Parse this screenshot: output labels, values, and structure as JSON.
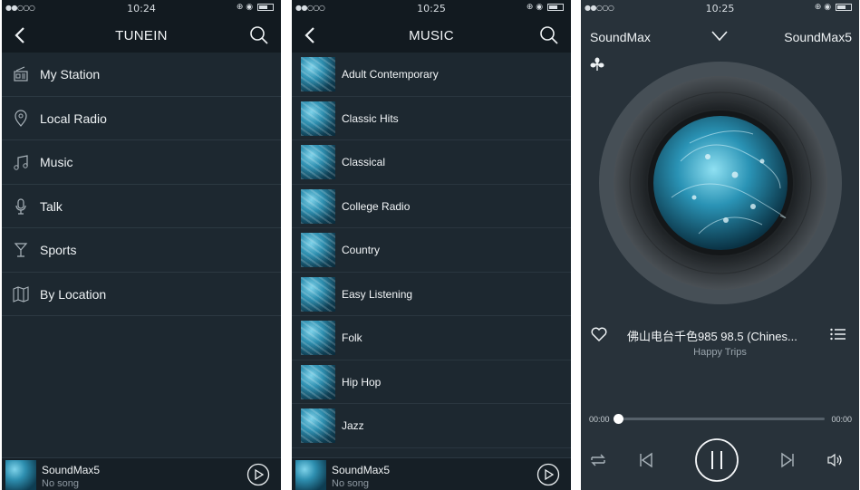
{
  "screens": [
    {
      "status": {
        "signal": "●●○○○",
        "time": "10:24"
      },
      "title": "TUNEIN",
      "menu": [
        {
          "label": "My Station",
          "icon": "radio-icon"
        },
        {
          "label": "Local Radio",
          "icon": "location-pin-icon"
        },
        {
          "label": "Music",
          "icon": "music-note-icon"
        },
        {
          "label": "Talk",
          "icon": "microphone-icon"
        },
        {
          "label": "Sports",
          "icon": "trophy-icon"
        },
        {
          "label": "By Location",
          "icon": "map-icon"
        }
      ],
      "mini_player": {
        "device": "SoundMax5",
        "status": "No song"
      }
    },
    {
      "status": {
        "signal": "●●○○○",
        "time": "10:25"
      },
      "title": "MUSIC",
      "genres": [
        "Adult Contemporary",
        "Classic Hits",
        "Classical",
        "College Radio",
        "Country",
        "Easy Listening",
        "Folk",
        "Hip Hop",
        "Jazz"
      ],
      "mini_player": {
        "device": "SoundMax5",
        "status": "No song"
      }
    },
    {
      "status": {
        "signal": "●●○○○",
        "time": "10:25"
      },
      "header": {
        "left": "SoundMax",
        "right": "SoundMax5"
      },
      "song": {
        "title": "佛山电台千色985 98.5 (Chines...",
        "artist": "Happy Trips"
      },
      "time_elapsed": "00:00",
      "time_total": "00:00",
      "progress": 0
    }
  ],
  "colors": {
    "background": "#1d2830",
    "bar": "#121a20",
    "accent": "#ffffff"
  }
}
